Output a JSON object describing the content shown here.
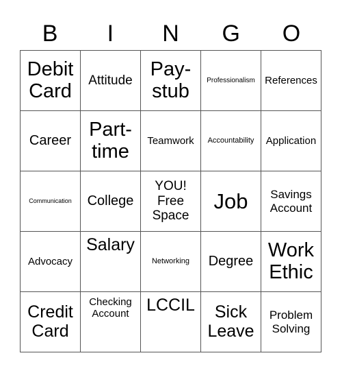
{
  "header": {
    "letters": [
      "B",
      "I",
      "N",
      "G",
      "O"
    ]
  },
  "cells": [
    "Debit Card",
    "Attitude",
    "Pay-stub",
    "Professionalism",
    "References",
    "Career",
    "Part-time",
    "Teamwork",
    "Accountability",
    "Application",
    "Communication",
    "College",
    "YOU! Free Space",
    "Job",
    "Savings Account",
    "Advocacy",
    "Salary",
    "Networking",
    "Degree",
    "Work Ethic",
    "Credit Card",
    "Checking Account",
    "LCCIL",
    "Sick Leave",
    "Problem Solving"
  ]
}
